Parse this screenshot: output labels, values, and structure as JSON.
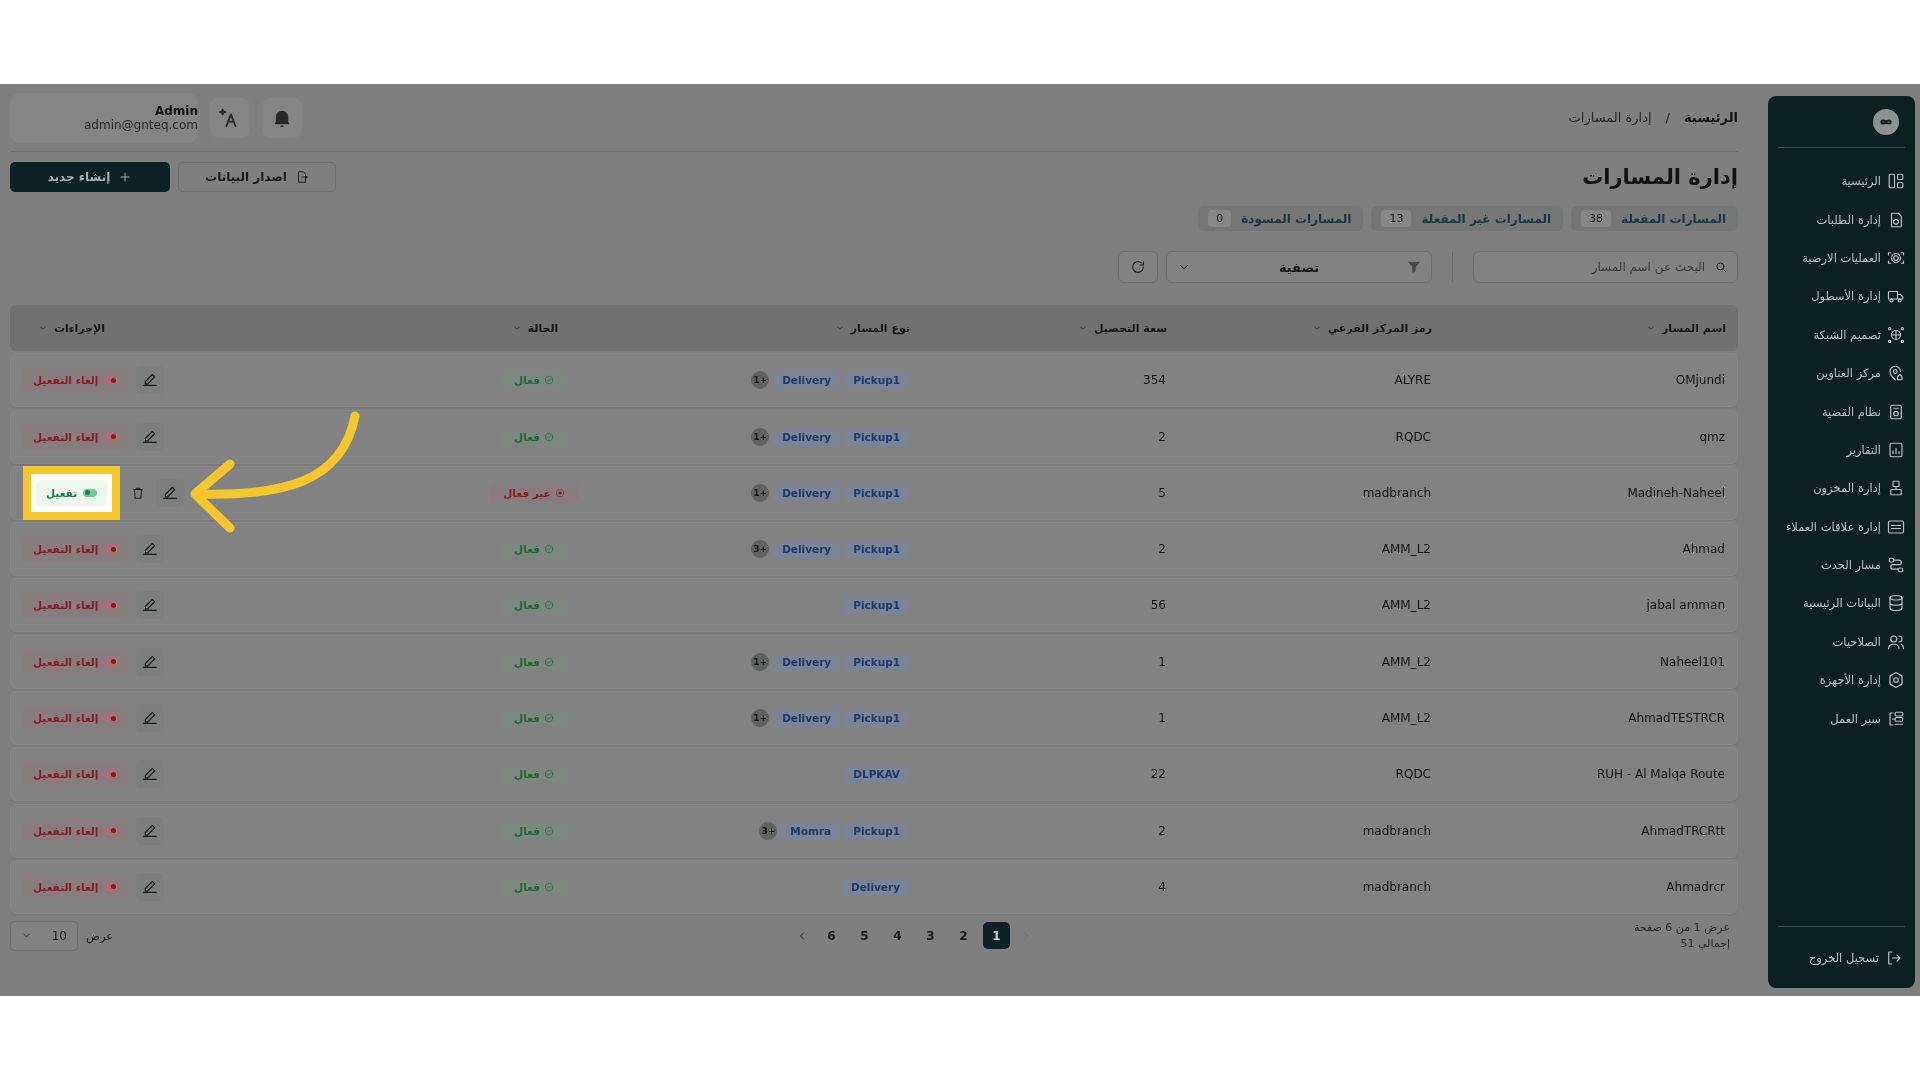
{
  "sidebar": {
    "items": [
      {
        "label": "الرئيسية"
      },
      {
        "label": "إدارة الطلبات"
      },
      {
        "label": "العمليات الارضية"
      },
      {
        "label": "إدارة الأسطول"
      },
      {
        "label": "تصميم الشبكة"
      },
      {
        "label": "مركز العناوين"
      },
      {
        "label": "نظام القضية"
      },
      {
        "label": "التقارير"
      },
      {
        "label": "إدارة المخزون"
      },
      {
        "label": "إدارة علاقات العملاء"
      },
      {
        "label": "مسار الحدث"
      },
      {
        "label": "البيانات الرئيسية"
      },
      {
        "label": "الصلاحيات"
      },
      {
        "label": "إدارة الأجهزة"
      },
      {
        "label": "سير العمل"
      }
    ],
    "logout": "تسجيل الخروج"
  },
  "topbar": {
    "breadcrumb": [
      "الرئيسية",
      "/",
      "إدارة المسارات"
    ],
    "user": {
      "name": "Admin",
      "email": "admin@gnteq.com"
    }
  },
  "page": {
    "title": "إدارة المسارات",
    "buttons": [
      {
        "kind": "export",
        "label": "اصدار البيانات"
      },
      {
        "kind": "create",
        "label": "إنشاء جديد"
      }
    ]
  },
  "tabs": [
    {
      "label": "المسارات المفعلة",
      "count": "38"
    },
    {
      "label": "المسارات غير المفعلة",
      "count": "13"
    },
    {
      "label": "المسارات المسودة",
      "count": "0"
    }
  ],
  "toolbar": {
    "search": {
      "placeholder": "البحث عن اسم المسار"
    },
    "filter": "تصفية"
  },
  "table": {
    "columns": [
      "اسم المسار",
      "رمز المركز الفرعي",
      "سعة التحصيل",
      "نوع المسار",
      "الحالة",
      "الإجراءات"
    ],
    "rows": [
      {
        "name": "OMjundi",
        "branch": "ALYRE",
        "capacity": "354",
        "route_types": [
          "Pickup1",
          "Delivery"
        ],
        "extra": "1+",
        "active": true,
        "status": "فعال",
        "action": "إلغاء التفعيل",
        "deletable": false,
        "highlighted": false
      },
      {
        "name": "qmz",
        "branch": "RQDC",
        "capacity": "2",
        "route_types": [
          "Pickup1",
          "Delivery"
        ],
        "extra": "1+",
        "active": true,
        "status": "فعال",
        "action": "إلغاء التفعيل",
        "deletable": false,
        "highlighted": false
      },
      {
        "name": "Madineh-Naheel",
        "branch": "madbranch",
        "capacity": "5",
        "route_types": [
          "Pickup1",
          "Delivery"
        ],
        "extra": "1+",
        "active": false,
        "status": "غير فعال",
        "action": "تفعيل",
        "deletable": true,
        "highlighted": true
      },
      {
        "name": "Ahmad",
        "branch": "AMM_L2",
        "capacity": "2",
        "route_types": [
          "Pickup1",
          "Delivery"
        ],
        "extra": "3+",
        "active": true,
        "status": "فعال",
        "action": "إلغاء التفعيل",
        "deletable": false,
        "highlighted": false
      },
      {
        "name": "jabal amman",
        "branch": "AMM_L2",
        "capacity": "56",
        "route_types": [
          "Pickup1"
        ],
        "active": true,
        "status": "فعال",
        "action": "إلغاء التفعيل",
        "deletable": false,
        "highlighted": false
      },
      {
        "name": "Naheel101",
        "branch": "AMM_L2",
        "capacity": "1",
        "route_types": [
          "Pickup1",
          "Delivery"
        ],
        "extra": "1+",
        "active": true,
        "status": "فعال",
        "action": "إلغاء التفعيل",
        "deletable": false,
        "highlighted": false
      },
      {
        "name": "AhmadTESTRCR",
        "branch": "AMM_L2",
        "capacity": "1",
        "route_types": [
          "Pickup1",
          "Delivery"
        ],
        "extra": "1+",
        "active": true,
        "status": "فعال",
        "action": "إلغاء التفعيل",
        "deletable": false,
        "highlighted": false
      },
      {
        "name": "RUH - Al Malqa Route",
        "branch": "RQDC",
        "capacity": "22",
        "route_types": [
          "DLPKAV"
        ],
        "active": true,
        "status": "فعال",
        "action": "إلغاء التفعيل",
        "deletable": false,
        "highlighted": false
      },
      {
        "name": "AhmadTRCRtt",
        "branch": "madbranch",
        "capacity": "2",
        "route_types": [
          "Pickup1",
          "Momra"
        ],
        "extra": "3+",
        "active": true,
        "status": "فعال",
        "action": "إلغاء التفعيل",
        "deletable": false,
        "highlighted": false
      },
      {
        "name": "Ahmadrcr",
        "branch": "madbranch",
        "capacity": "4",
        "route_types": [
          "Delivery"
        ],
        "active": true,
        "status": "فعال",
        "action": "إلغاء التفعيل",
        "deletable": false,
        "highlighted": false
      }
    ]
  },
  "pagination": {
    "info": "عرض 1 من 6 صفحة",
    "total": "إجمالي 51",
    "previous": {
      "disabled": true
    },
    "next": {
      "disabled": false
    },
    "pages": [
      {
        "label": "1",
        "selected": true
      },
      {
        "label": "2",
        "selected": false
      },
      {
        "label": "3",
        "selected": false
      },
      {
        "label": "4",
        "selected": false
      },
      {
        "label": "5",
        "selected": false
      },
      {
        "label": "6",
        "selected": false
      }
    ],
    "page_size": "10",
    "page_size_label": "عرض"
  }
}
